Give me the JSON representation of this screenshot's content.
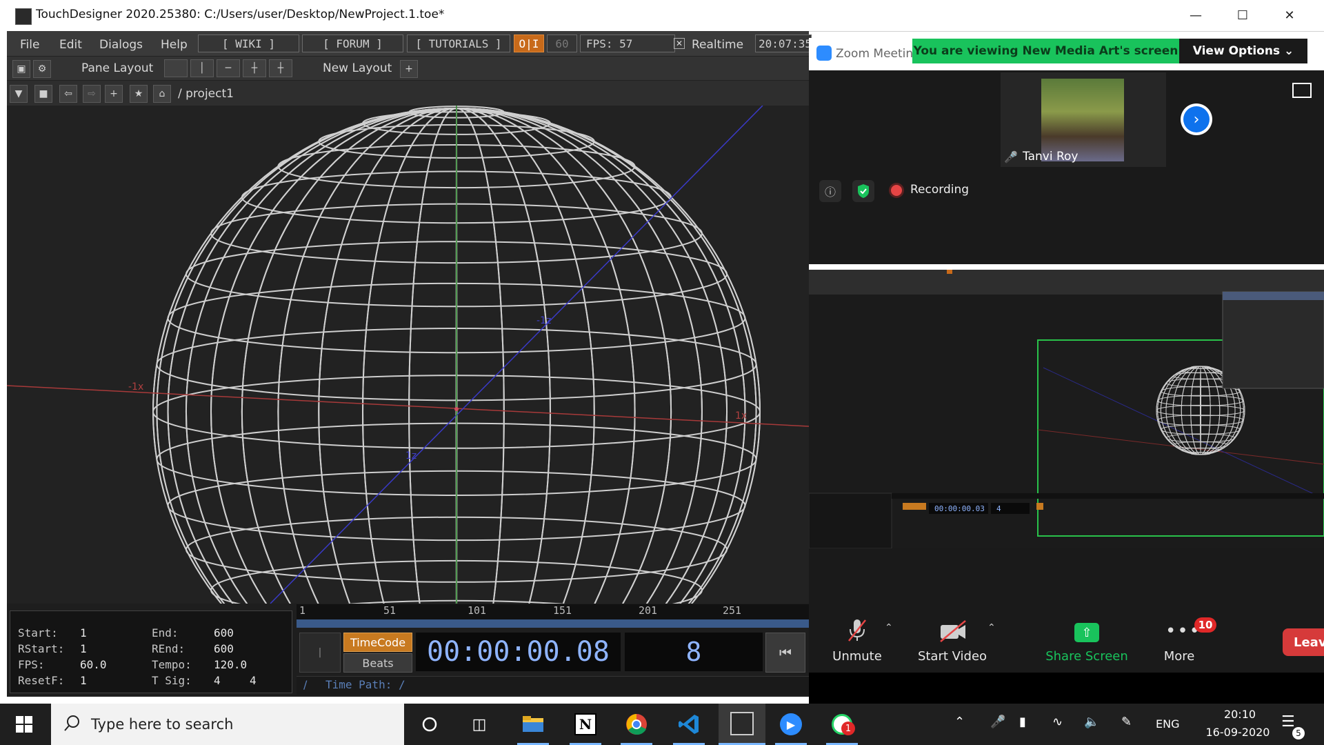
{
  "td_window": {
    "title": "TouchDesigner 2020.25380: C:/Users/user/Desktop/NewProject.1.toe*",
    "menu": [
      "File",
      "Edit",
      "Dialogs",
      "Help"
    ],
    "links": [
      "[ WIKI ]",
      "[ FORUM ]",
      "[ TUTORIALS ]"
    ],
    "oi_label": "O|I",
    "fps_target": "60",
    "fps_label": "FPS:  57",
    "realtime_label": "Realtime",
    "clock": "20:07:35",
    "pane_layout_label": "Pane Layout",
    "new_layout_label": "New Layout",
    "path": "/ project1",
    "axis_labels": {
      "neg_x": "-1x",
      "pos_x": "1x",
      "neg_z": "-1z",
      "pos_z": "1z"
    },
    "timeline_ticks": [
      "1",
      "51",
      "101",
      "151",
      "201",
      "251"
    ],
    "stats": {
      "start_label": "Start:",
      "start": "1",
      "end_label": "End:",
      "end": "600",
      "rstart_label": "RStart:",
      "rstart": "1",
      "rend_label": "REnd:",
      "rend": "600",
      "fps_label": "FPS:",
      "fps": "60.0",
      "tempo_label": "Tempo:",
      "tempo": "120.0",
      "resetf_label": "ResetF:",
      "resetf": "1",
      "tsig_label": "T Sig:",
      "tsig_a": "4",
      "tsig_b": "4"
    },
    "timecode_label": "TimeCode",
    "beats_label": "Beats",
    "timecode": "00:00:00.08",
    "frame": "8",
    "time_path": "Time Path: /",
    "time_path_slash": "/"
  },
  "zoom": {
    "title": "Zoom Meeting",
    "viewing_banner": "You are viewing New Media Art's screen",
    "view_options": "View Options ⌄",
    "participant_name": "Tanvi Roy",
    "recording_label": "Recording",
    "shared_timecode": "00:00:00.03",
    "shared_frame": "4",
    "controls": {
      "unmute": "Unmute",
      "start_video": "Start Video",
      "share_screen": "Share Screen",
      "more": "More",
      "more_badge": "10",
      "leave": "Leave"
    }
  },
  "taskbar": {
    "search_placeholder": "Type here to search",
    "language": "ENG",
    "time": "20:10",
    "date": "16-09-2020",
    "notif_count": "5",
    "whatsapp_badge": "1"
  }
}
